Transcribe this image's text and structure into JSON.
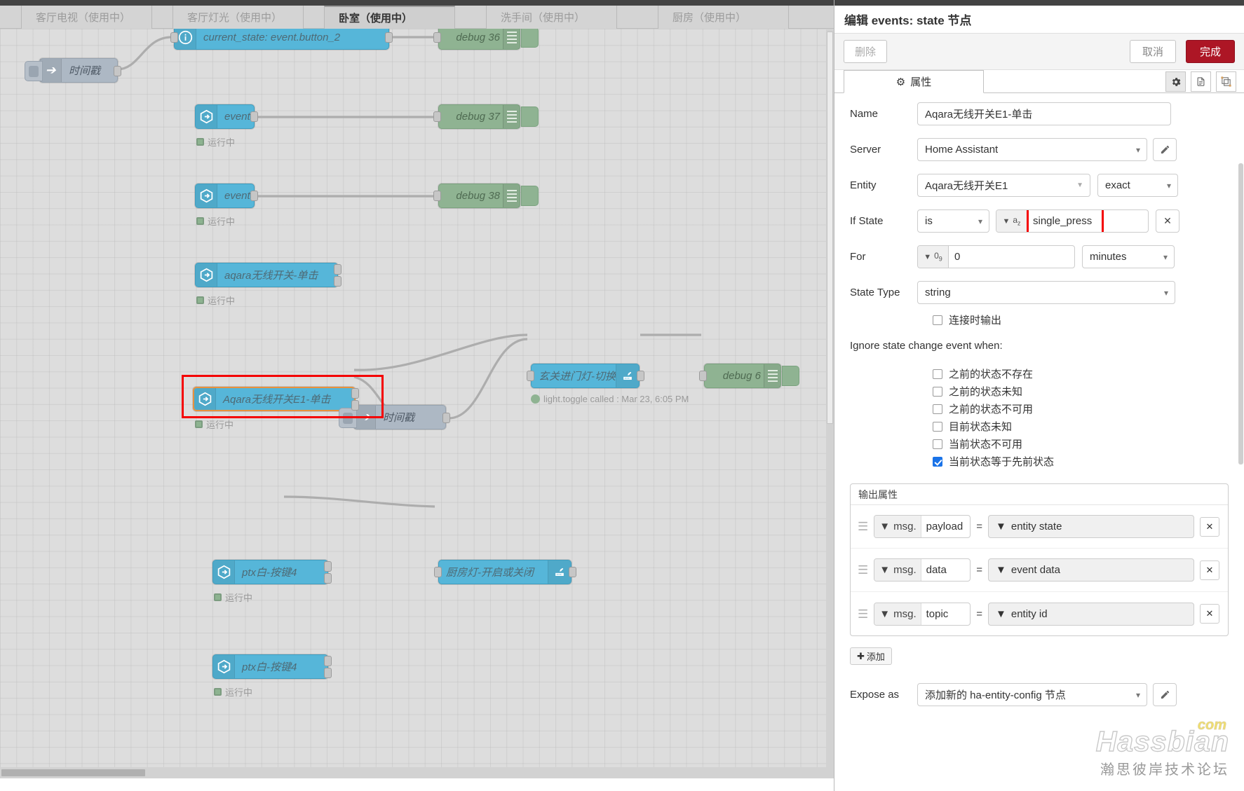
{
  "workspace": {
    "tabs": [
      {
        "label": "客厅电视（使用中）",
        "active": false
      },
      {
        "label": "客厅灯光（使用中）",
        "active": false
      },
      {
        "label": "卧室（使用中）",
        "active": true
      },
      {
        "label": "洗手间（使用中）",
        "active": false
      },
      {
        "label": "厨房（使用中）",
        "active": false
      }
    ],
    "nodes": {
      "inject1": "时间戳",
      "current_state": "current_state: event.button_2",
      "debug36": "debug 36",
      "events_state_1": "events state",
      "debug37": "debug 37",
      "events_state_2": "events state",
      "debug38": "debug 38",
      "aqara_switch": "aqara无线开关-单击",
      "aqara_e1": "Aqara无线开关E1-单击",
      "entry_light": "玄关进门灯-切换",
      "debug6": "debug 6",
      "inject2": "时间戳",
      "ptx1": "ptx白-按键4",
      "kitchen_light": "厨房灯-开启或关闭",
      "ptx2": "ptx白-按键4"
    },
    "status": {
      "running": "运行中",
      "light_toggle": "light.toggle called : Mar 23, 6:05 PM"
    }
  },
  "panel": {
    "title": "编辑 events: state 节点",
    "buttons": {
      "delete": "删除",
      "cancel": "取消",
      "done": "完成"
    },
    "tab_properties": "属性",
    "icons": {
      "gear": "gear-icon",
      "doc": "description-icon",
      "appearance": "appearance-icon"
    },
    "form": {
      "name": {
        "label": "Name",
        "value": "Aqara无线开关E1-单击"
      },
      "server": {
        "label": "Server",
        "value": "Home Assistant"
      },
      "entity": {
        "label": "Entity",
        "value": "Aqara无线开关E1",
        "match": "exact"
      },
      "ifstate": {
        "label": "If State",
        "op": "is",
        "type": "a z",
        "value": "single_press"
      },
      "for": {
        "label": "For",
        "type": "0 9",
        "value": "0",
        "unit": "minutes"
      },
      "statetype": {
        "label": "State Type",
        "value": "string"
      },
      "output_on_connect": "连接时输出",
      "ignore_heading": "Ignore state change event when:",
      "ignore_options": [
        {
          "label": "之前的状态不存在",
          "checked": false
        },
        {
          "label": "之前的状态未知",
          "checked": false
        },
        {
          "label": "之前的状态不可用",
          "checked": false
        },
        {
          "label": "目前状态未知",
          "checked": false
        },
        {
          "label": "当前状态不可用",
          "checked": false
        },
        {
          "label": "当前状态等于先前状态",
          "checked": true
        }
      ],
      "output_props": {
        "heading": "输出属性",
        "rows": [
          {
            "prefix": "msg.",
            "prop": "payload",
            "eq": "=",
            "value": "entity state"
          },
          {
            "prefix": "msg.",
            "prop": "data",
            "eq": "=",
            "value": "event data"
          },
          {
            "prefix": "msg.",
            "prop": "topic",
            "eq": "=",
            "value": "entity id"
          }
        ],
        "add": "添加"
      },
      "expose": {
        "label": "Expose as",
        "value": "添加新的 ha-entity-config 节点"
      }
    },
    "watermark": {
      "brand": "Hassbian",
      "tld": "com",
      "sub": "瀚思彼岸技术论坛"
    }
  },
  "colors": {
    "accent_red": "#ad1625",
    "node_ha": "#56b6d9",
    "node_debug": "#8fb392",
    "node_inject": "#adb8c4",
    "selected_outline": "#e8913c",
    "highlight_box": "#f40000",
    "checkbox_checked": "#1a73e8"
  }
}
